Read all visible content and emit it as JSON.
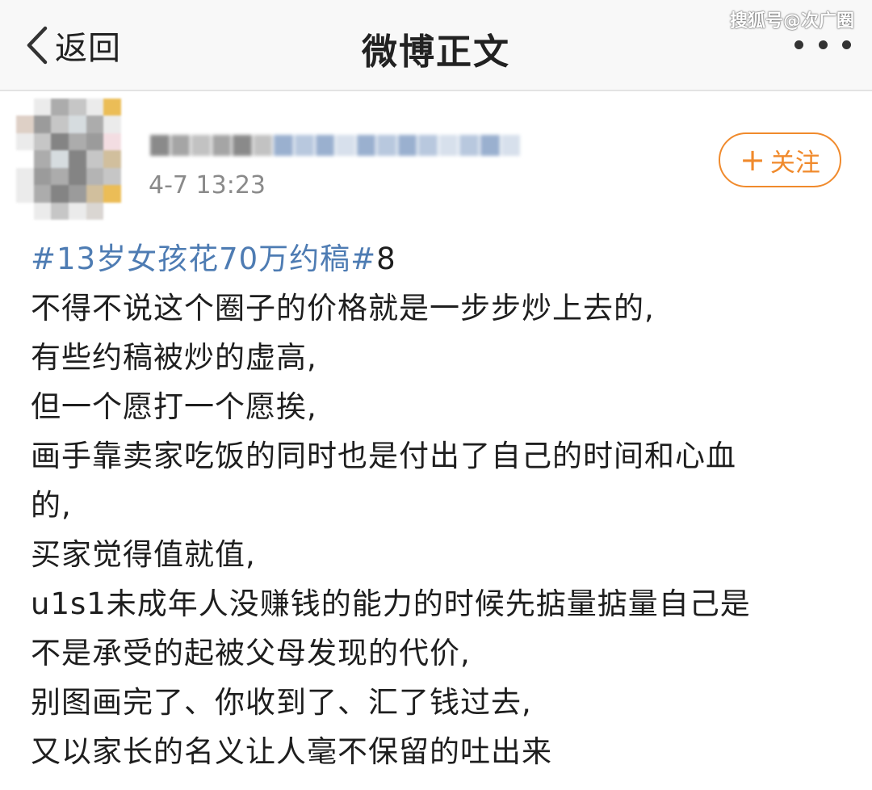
{
  "nav": {
    "back_label": "返回",
    "title": "微博正文",
    "watermark": "搜狐号@次广圈"
  },
  "post": {
    "timestamp": "4-7 13:23",
    "follow_label": "关注",
    "topic": "#13岁女孩花70万约稿#",
    "topic_suffix": "8",
    "lines": [
      "不得不说这个圈子的价格就是一步步炒上去的,",
      "有些约稿被炒的虚高,",
      "但一个愿打一个愿挨,",
      "画手靠卖家吃饭的同时也是付出了自己的时间和心血",
      "的,",
      "买家觉得值就值,",
      "u1s1未成年人没赚钱的能力的时候先掂量掂量自己是",
      "不是承受的起被父母发现的代价,",
      "别图画完了、你收到了、汇了钱过去,",
      "又以家长的名义让人毫不保留的吐出来"
    ]
  },
  "colors": {
    "accent": "#f08a2c",
    "topic": "#4e7cb3",
    "text": "#1e1e1e",
    "muted": "#8a8a8a"
  },
  "icons": {
    "back": "chevron-left-icon",
    "more": "more-dots-icon",
    "plus": "plus-icon"
  }
}
